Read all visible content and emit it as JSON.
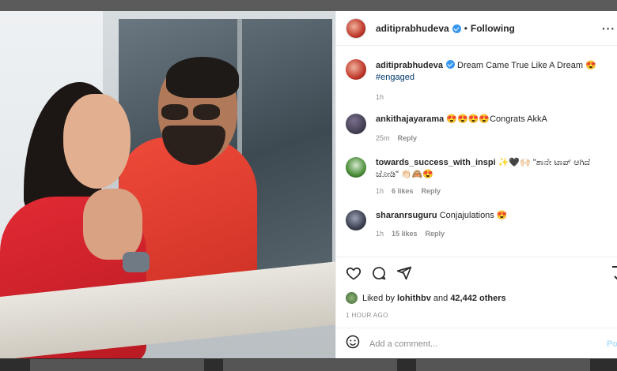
{
  "post": {
    "username": "aditiprabhudeva",
    "follow_status": "Following",
    "more_label": "···",
    "caption_text": "Dream Came True Like A Dream",
    "caption_emoji": "😍",
    "hashtag": "#engaged",
    "caption_time": "1h"
  },
  "comments": [
    {
      "username": "ankithajayarama",
      "text": "😍😍😍😍Congrats AkkA",
      "time": "25m",
      "likes": "",
      "reply": "Reply"
    },
    {
      "username": "towards_success_with_inspi",
      "text": "✨🖤🙌🏻 \"ಶಾನೇ ಟಾಪ್ ಆಗಿದೆ ಜೋಡಿ\" 👏🏻🙈😍",
      "time": "1h",
      "likes": "6 likes",
      "reply": "Reply"
    },
    {
      "username": "sharanrsuguru",
      "text": "Conjajulations 😍",
      "time": "1h",
      "likes": "15 likes",
      "reply": "Reply"
    }
  ],
  "likes": {
    "prefix": "Liked by",
    "user": "lohithbv",
    "middle": "and",
    "count": "42,442 others"
  },
  "timestamp": "1 HOUR AGO",
  "add_comment": {
    "placeholder": "Add a comment...",
    "post_label": "Po"
  },
  "icons": [
    "heart-icon",
    "comment-icon",
    "share-icon",
    "bookmark-icon",
    "emoji-icon"
  ]
}
